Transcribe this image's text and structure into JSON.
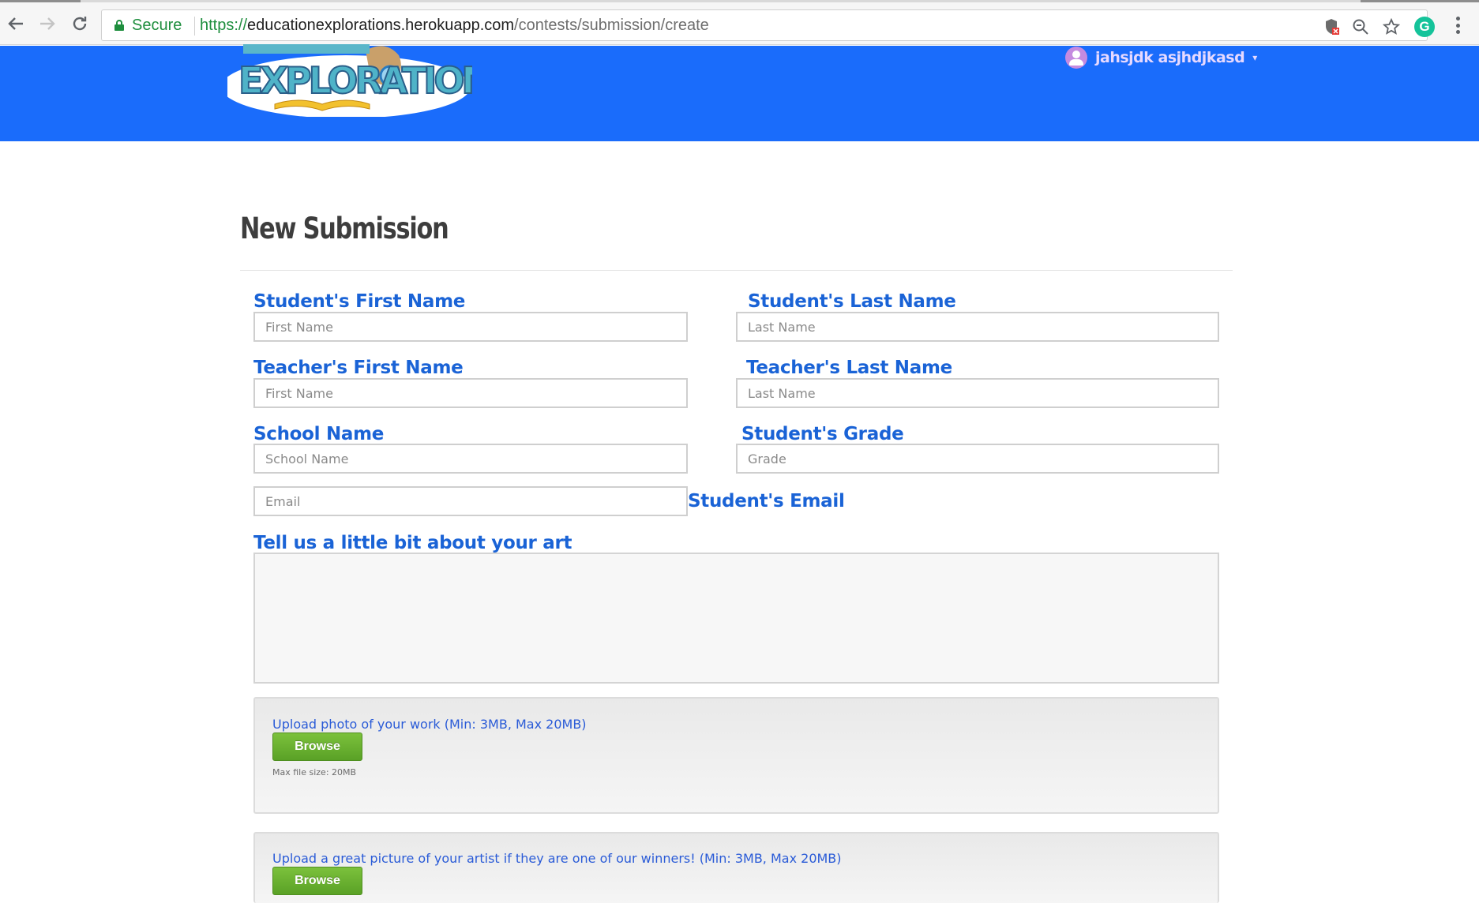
{
  "browser": {
    "secure_label": "Secure",
    "url_scheme": "https://",
    "url_host": "educationexplorations.herokuapp.com",
    "url_path": "/contests/submission/create"
  },
  "header": {
    "logo_text": "EXPLORATIONS",
    "user_name": "jahsjdk asjhdjkasd",
    "brand_color": "#1a6cfb"
  },
  "page": {
    "title": "New Submission"
  },
  "form": {
    "student_first": {
      "label": "Student's First Name",
      "placeholder": "First Name"
    },
    "student_last": {
      "label": "Student's Last Name",
      "placeholder": "Last Name"
    },
    "teacher_first": {
      "label": "Teacher's First Name",
      "placeholder": "First Name"
    },
    "teacher_last": {
      "label": "Teacher's Last Name",
      "placeholder": "Last Name"
    },
    "school": {
      "label": "School Name",
      "placeholder": "School Name"
    },
    "grade": {
      "label": "Student's Grade",
      "placeholder": "Grade"
    },
    "email": {
      "label": "Student's Email",
      "placeholder": "Email"
    },
    "about": {
      "label": "Tell us a little bit about your art"
    },
    "upload_work": {
      "label": "Upload photo of your work (Min: 3MB, Max 20MB)",
      "button": "Browse",
      "note": "Max file size: 20MB"
    },
    "upload_artist": {
      "label": "Upload a great picture of your artist if they are one of our winners! (Min: 3MB, Max 20MB)",
      "button": "Browse"
    }
  }
}
